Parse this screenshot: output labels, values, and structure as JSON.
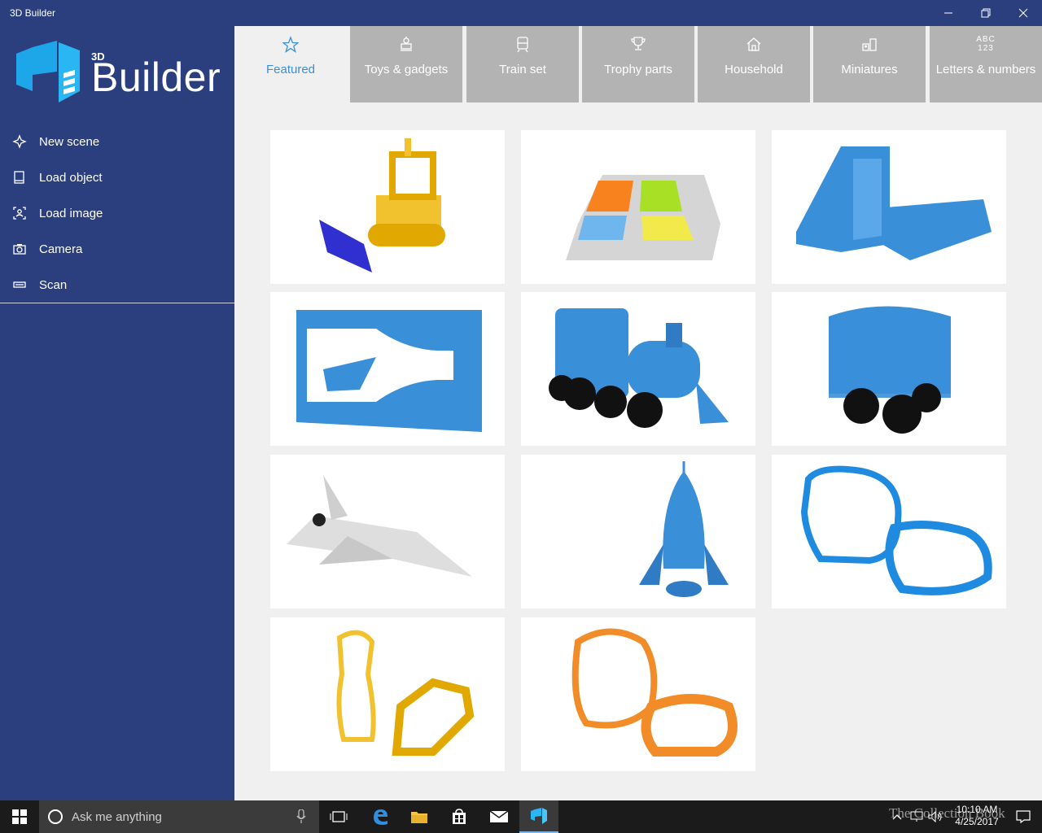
{
  "window": {
    "title": "3D Builder"
  },
  "logo": {
    "small": "3D",
    "big": "Builder"
  },
  "menu": [
    {
      "label": "New scene",
      "icon": "new-scene-icon"
    },
    {
      "label": "Load object",
      "icon": "load-object-icon"
    },
    {
      "label": "Load image",
      "icon": "load-image-icon"
    },
    {
      "label": "Camera",
      "icon": "camera-icon"
    },
    {
      "label": "Scan",
      "icon": "scan-icon"
    }
  ],
  "tabs": [
    {
      "label": "Featured",
      "icon": "star-icon",
      "active": true
    },
    {
      "label": "Toys & gadgets",
      "icon": "robot-icon"
    },
    {
      "label": "Train set",
      "icon": "train-icon"
    },
    {
      "label": "Trophy parts",
      "icon": "trophy-icon"
    },
    {
      "label": "Household",
      "icon": "house-icon"
    },
    {
      "label": "Miniatures",
      "icon": "miniatures-icon"
    },
    {
      "label": "Letters & numbers",
      "icon": "abc-123-icon",
      "icon_text": [
        "ABC",
        "123"
      ]
    }
  ],
  "models": [
    {
      "name": "bulldozer",
      "color": "#f2c12e"
    },
    {
      "name": "windows-logo-tray",
      "color": "#f25022"
    },
    {
      "name": "raspberry-pi-case",
      "color": "#3a8fd9"
    },
    {
      "name": "ship-in-bottle-frame",
      "color": "#3a8fd9"
    },
    {
      "name": "train-locomotive",
      "color": "#3a8fd9"
    },
    {
      "name": "train-wagon",
      "color": "#3a8fd9"
    },
    {
      "name": "space-shuttle",
      "color": "#d9d9d9"
    },
    {
      "name": "rocket",
      "color": "#3a8fd9"
    },
    {
      "name": "elephant-cookie-cutter",
      "color": "#3a8fd9"
    },
    {
      "name": "giraffe-cookie-cutter",
      "color": "#f2c12e"
    },
    {
      "name": "lion-cookie-cutter",
      "color": "#f28c28"
    }
  ],
  "taskbar": {
    "search_placeholder": "Ask me anything",
    "time": "10:10 AM",
    "date": "4/25/2017",
    "watermark": "The Collection Book"
  },
  "colors": {
    "sidebar": "#2b3f7e",
    "accent": "#3a8fd9",
    "tab_inactive": "#b3b3b3"
  }
}
